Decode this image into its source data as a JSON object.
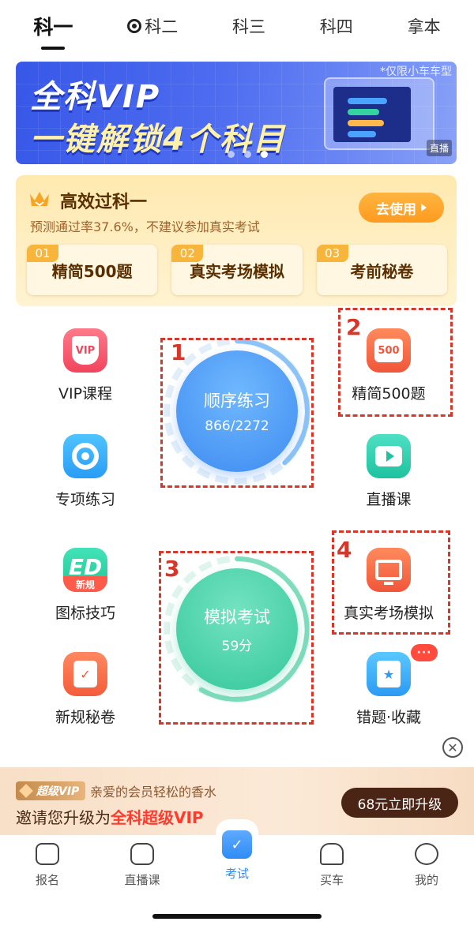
{
  "tabs": [
    "科一",
    "科二",
    "科三",
    "科四",
    "拿本"
  ],
  "banner": {
    "title_line1": "全科VIP",
    "title_line2": "一键解锁4个科目",
    "note": "*仅限小车车型",
    "live_tag": "直播"
  },
  "promo": {
    "title": "高效过科一",
    "subtitle": "预测通过率37.6%，不建议参加真实考试",
    "button": "去使用",
    "items": [
      {
        "num": "01",
        "label": "精简500题"
      },
      {
        "num": "02",
        "label": "真实考场模拟"
      },
      {
        "num": "03",
        "label": "考前秘卷"
      }
    ]
  },
  "grid": {
    "vip": {
      "label": "VIP课程",
      "icon_text": "VIP"
    },
    "special": {
      "label": "专项练习"
    },
    "signs": {
      "label": "图标技巧",
      "icon_text": "ED",
      "tag": "新规"
    },
    "rules": {
      "label": "新规秘卷"
    },
    "q500": {
      "label": "精简500题",
      "icon_text": "500"
    },
    "live": {
      "label": "直播课"
    },
    "exam": {
      "label": "真实考场模拟"
    },
    "wrong": {
      "label": "错题·收藏",
      "badge": "···"
    }
  },
  "practice": {
    "title": "顺序练习",
    "progress_text": "866/2272",
    "done": 866,
    "total": 2272
  },
  "mock": {
    "title": "模拟考试",
    "score": "59分"
  },
  "annotations": [
    "1",
    "2",
    "3",
    "4"
  ],
  "upgrade": {
    "badge": "超级VIP",
    "line1": "亲爱的会员轻松的香水",
    "line2_prefix": "邀请您升级为",
    "line2_highlight": "全科超级VIP",
    "button": "68元立即升级"
  },
  "nav": [
    "报名",
    "直播课",
    "考试",
    "买车",
    "我的"
  ],
  "colors": {
    "accent": "#2f8cf5",
    "annotation": "#d9362a"
  }
}
